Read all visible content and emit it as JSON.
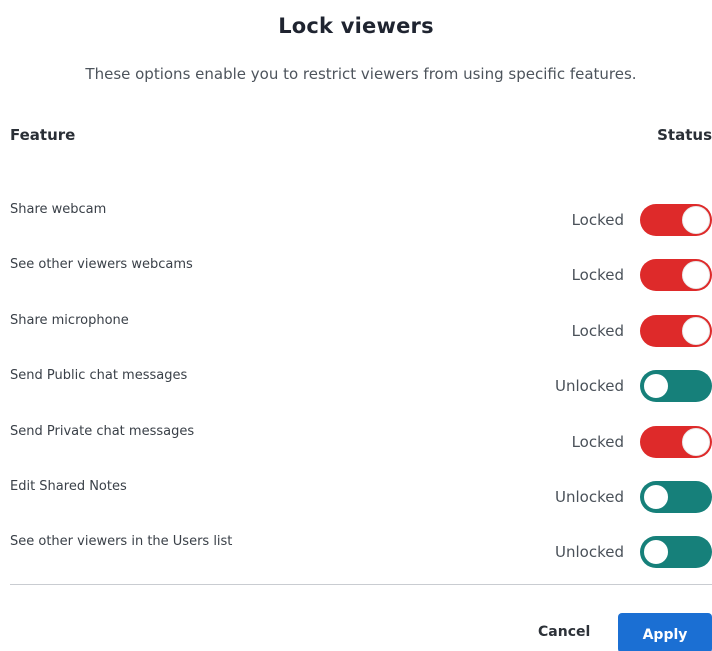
{
  "dialog": {
    "title": "Lock viewers",
    "subtitle": "These options enable you to restrict viewers from using specific features."
  },
  "table": {
    "feature_header": "Feature",
    "status_header": "Status",
    "rows": [
      {
        "label": "Share webcam",
        "status": "Locked",
        "locked": true
      },
      {
        "label": "See other viewers webcams",
        "status": "Locked",
        "locked": true
      },
      {
        "label": "Share microphone",
        "status": "Locked",
        "locked": true
      },
      {
        "label": "Send Public chat messages",
        "status": "Unlocked",
        "locked": false
      },
      {
        "label": "Send Private chat messages",
        "status": "Locked",
        "locked": true
      },
      {
        "label": "Edit Shared Notes",
        "status": "Unlocked",
        "locked": false
      },
      {
        "label": "See other viewers in the Users list",
        "status": "Unlocked",
        "locked": false
      }
    ]
  },
  "actions": {
    "cancel_label": "Cancel",
    "apply_label": "Apply"
  },
  "colors": {
    "locked": "#de2a2a",
    "unlocked": "#16807a",
    "primary": "#1b6fd3"
  }
}
